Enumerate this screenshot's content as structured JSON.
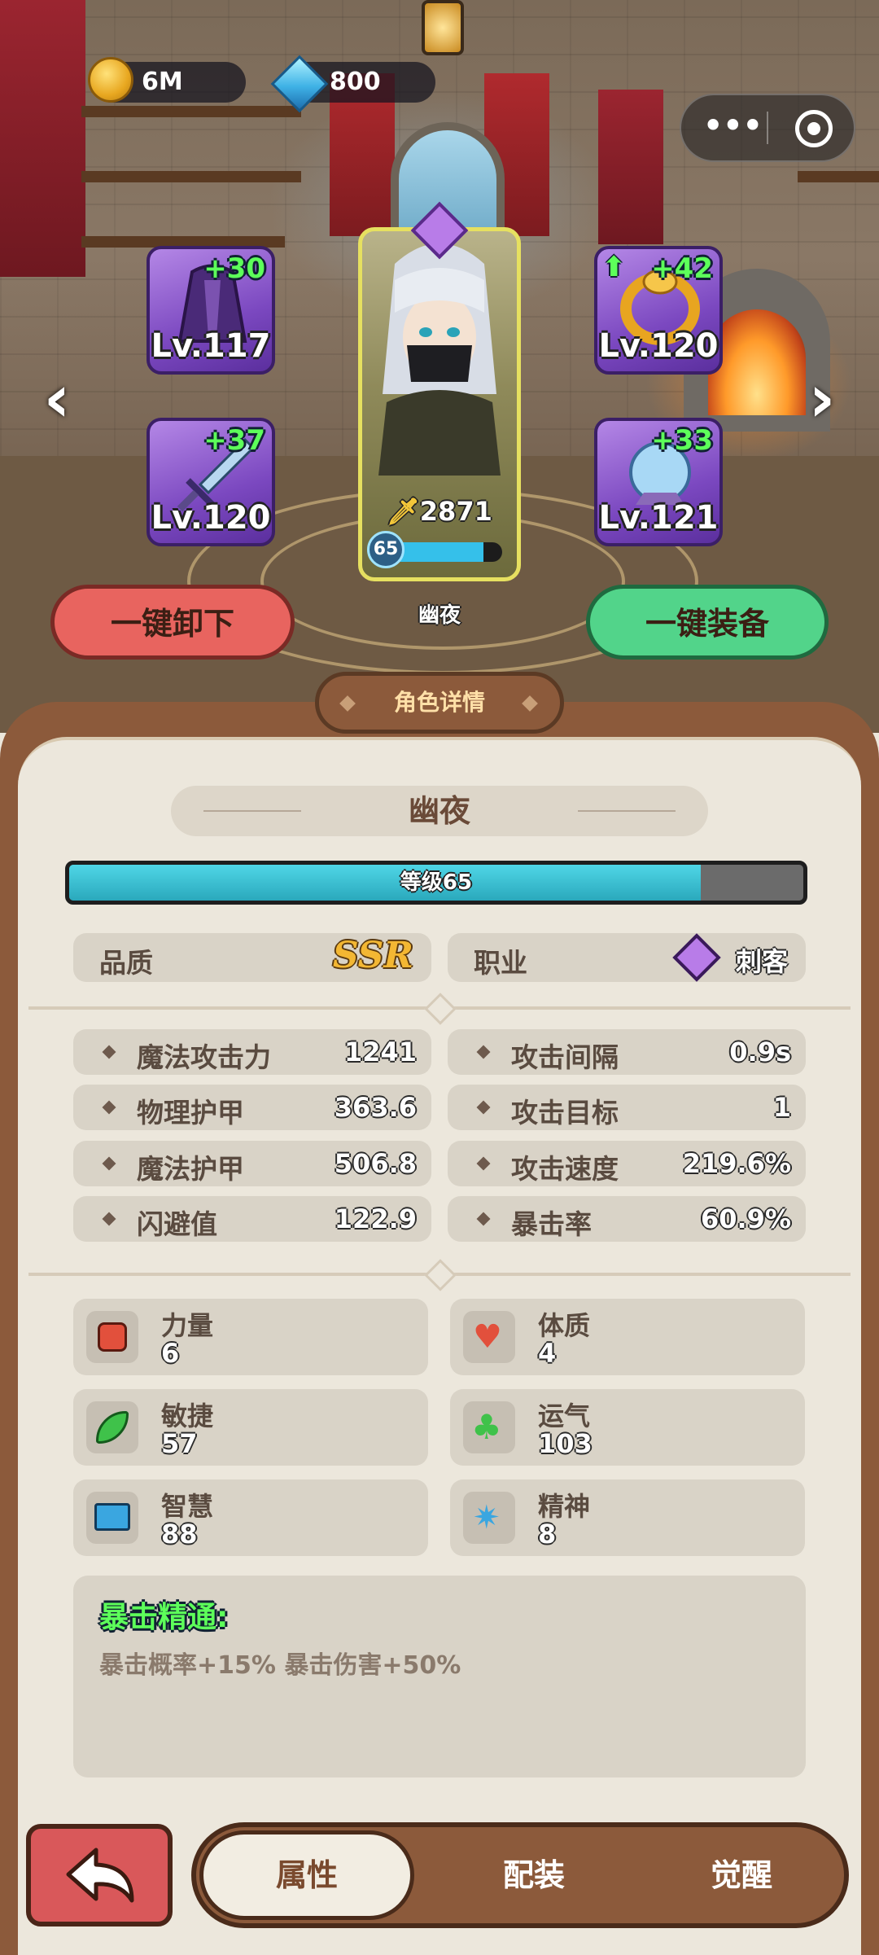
{
  "currency": {
    "gold": "6M",
    "gems": "800"
  },
  "equipment": {
    "top_left": {
      "plus": "+30",
      "level": "Lv.117",
      "icon": "robe-icon"
    },
    "bottom_left": {
      "plus": "+37",
      "level": "Lv.120",
      "icon": "sword-icon"
    },
    "top_right": {
      "plus": "+42",
      "level": "Lv.120",
      "icon": "ring-icon"
    },
    "bottom_right": {
      "plus": "+33",
      "level": "Lv.121",
      "icon": "orb-icon"
    }
  },
  "hero": {
    "power": "2871",
    "level": "65",
    "name": "幽夜",
    "level_fill": 0.85
  },
  "buttons": {
    "unequip_all": "一键卸下",
    "equip_all": "一键装备"
  },
  "section_title": "角色详情",
  "details": {
    "name": "幽夜",
    "level_label": "等级65",
    "level_progress": 0.86,
    "quality_label": "品质",
    "quality_value": "SSR",
    "class_label": "职业",
    "class_value": "刺客"
  },
  "stats_left": [
    {
      "name": "魔法攻击力",
      "value": "1241"
    },
    {
      "name": "物理护甲",
      "value": "363.6"
    },
    {
      "name": "魔法护甲",
      "value": "506.8"
    },
    {
      "name": "闪避值",
      "value": "122.9"
    }
  ],
  "stats_right": [
    {
      "name": "攻击间隔",
      "value": "0.9s"
    },
    {
      "name": "攻击目标",
      "value": "1"
    },
    {
      "name": "攻击速度",
      "value": "219.6%"
    },
    {
      "name": "暴击率",
      "value": "60.9%"
    }
  ],
  "attributes": [
    {
      "name": "力量",
      "value": "6",
      "icon": "fist-icon",
      "color": "#e2503c"
    },
    {
      "name": "体质",
      "value": "4",
      "icon": "heart-icon",
      "color": "#e2503c"
    },
    {
      "name": "敏捷",
      "value": "57",
      "icon": "wing-icon",
      "color": "#3fc24a"
    },
    {
      "name": "运气",
      "value": "103",
      "icon": "clover-icon",
      "color": "#3fc24a"
    },
    {
      "name": "智慧",
      "value": "88",
      "icon": "book-icon",
      "color": "#3aa6e0"
    },
    {
      "name": "精神",
      "value": "8",
      "icon": "spirit-icon",
      "color": "#3aa6e0"
    }
  ],
  "skill": {
    "title": "暴击精通:",
    "desc": "暴击概率+15% 暴击伤害+50%"
  },
  "tabs": {
    "attributes": "属性",
    "equipment": "配装",
    "awaken": "觉醒"
  },
  "colors": {
    "accent": "#2fb7c9",
    "panel_brown": "#8c5a3b",
    "unequip_red": "#e8645f",
    "equip_green": "#52d48a"
  }
}
